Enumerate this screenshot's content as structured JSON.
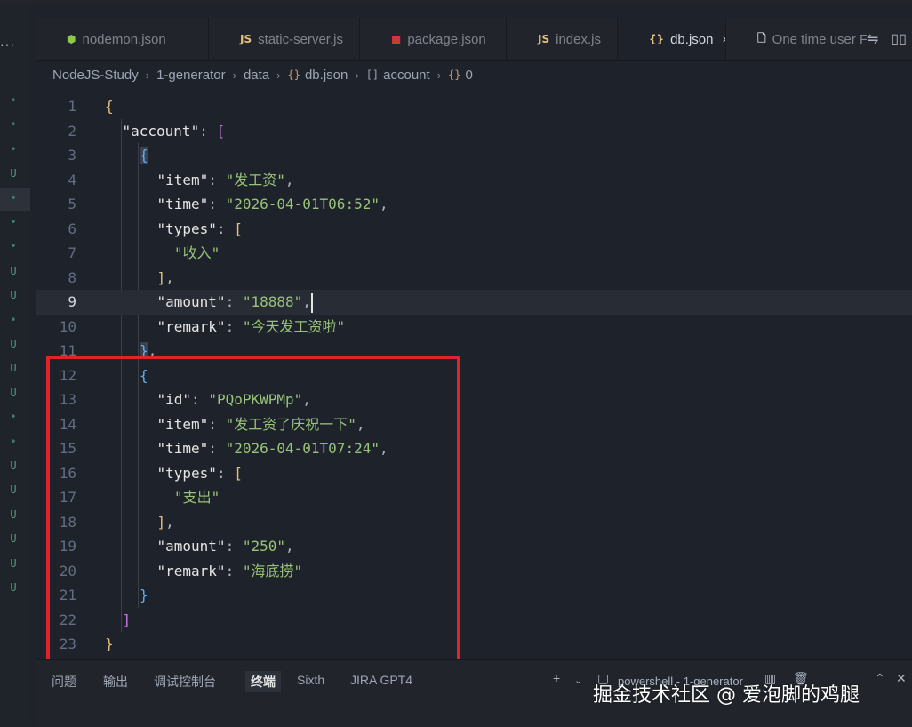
{
  "tabs": [
    {
      "label": "nodemon.json",
      "icon": "nodemon-icon",
      "icon_glyph": "⬢",
      "icon_color": "#8cc84b"
    },
    {
      "label": "static-server.js",
      "icon": "js-icon",
      "icon_glyph": "JS",
      "icon_color": "#e5c07b"
    },
    {
      "label": "package.json",
      "icon": "npm-icon",
      "icon_glyph": "■",
      "icon_color": "#cb3837"
    },
    {
      "label": "index.js",
      "icon": "js-icon",
      "icon_glyph": "JS",
      "icon_color": "#e5c07b"
    },
    {
      "label": "db.json",
      "icon": "json-icon",
      "icon_glyph": "{}",
      "icon_color": "#e5c07b",
      "active": true,
      "close": "×"
    },
    {
      "label": "One time user F",
      "icon": "file-icon",
      "icon_glyph": "🗋",
      "icon_color": "#d7dae0"
    }
  ],
  "breadcrumb": {
    "items": [
      "NodeJS-Study",
      "1-generator",
      "data",
      "db.json",
      "account",
      "0"
    ],
    "icon_json": "{}",
    "icon_array": "[]",
    "sep": "›"
  },
  "code_lines": [
    "{",
    "\"account\": [",
    "{",
    "\"item\": \"发工资\",",
    "\"time\": \"2026-04-01T06:52\",",
    "\"types\": [",
    "\"收入\"",
    "],",
    "\"amount\": \"18888\",",
    "\"remark\": \"今天发工资啦\"",
    "},",
    "{",
    "\"id\": \"PQoPKWPMp\",",
    "\"item\": \"发工资了庆祝一下\",",
    "\"time\": \"2026-04-01T07:24\",",
    "\"types\": [",
    "\"支出\"",
    "],",
    "\"amount\": \"250\",",
    "\"remark\": \"海底捞\"",
    "}",
    "]",
    "}"
  ],
  "current_line": 9,
  "gutter_status": [
    "•",
    "•",
    "•",
    "U",
    "•",
    "•",
    "•",
    "U",
    "U",
    "•",
    "U",
    "U",
    "U",
    "•",
    "•",
    "U",
    "U",
    "U",
    "U",
    "U",
    "U"
  ],
  "panel": {
    "tabs": [
      "问题",
      "输出",
      "调试控制台",
      "终端",
      "Sixth",
      "JIRA GPT4"
    ],
    "active": "终端",
    "terminal_label": "powershell - 1-generator",
    "add": "+",
    "chevron": "⌄"
  },
  "watermark": "掘金技术社区 @ 爱泡脚的鸡腿",
  "activity": {
    "more": "···"
  }
}
